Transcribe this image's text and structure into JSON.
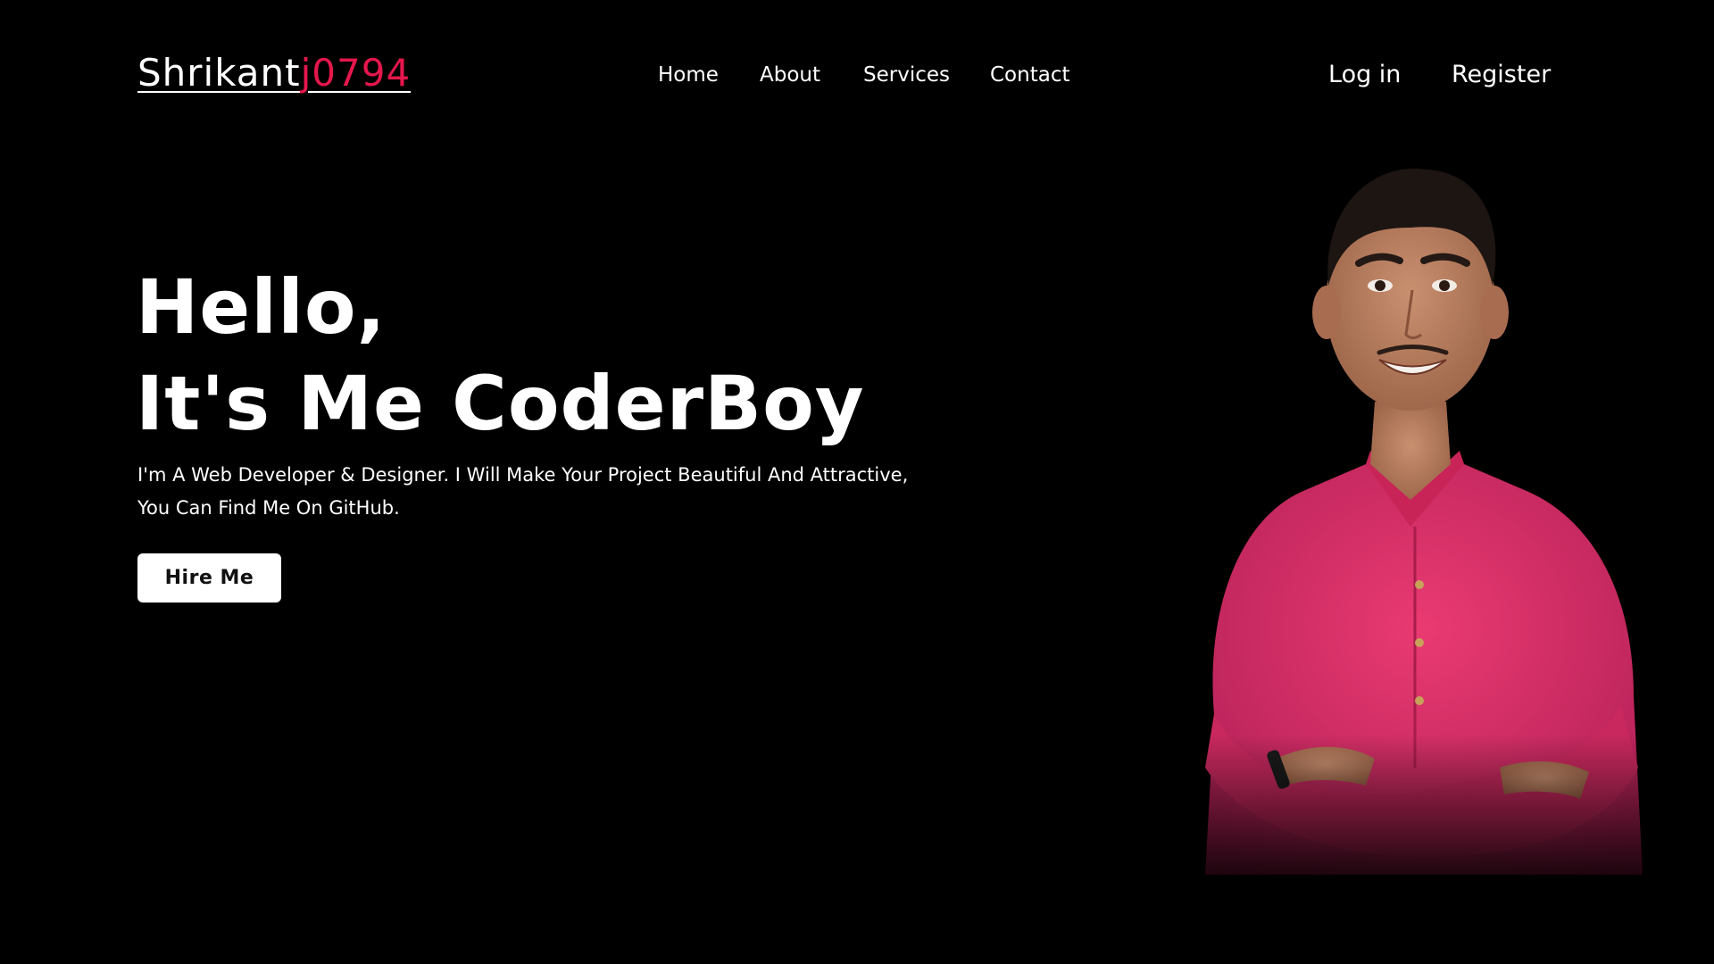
{
  "header": {
    "logo_main": "Shrikant",
    "logo_accent": "j0794",
    "nav": [
      "Home",
      "About",
      "Services",
      "Contact"
    ],
    "login_label": "Log in",
    "register_label": "Register"
  },
  "hero": {
    "title_line1": "Hello,",
    "title_line2": "It's Me CoderBoy",
    "description_line1": "I'm A Web Developer & Designer. I Will Make Your Project Beautiful And Attractive,",
    "description_line2": "You Can Find Me On GitHub.",
    "cta_label": "Hire Me"
  },
  "colors": {
    "background": "#000000",
    "text": "#ffffff",
    "accent": "#e5174c",
    "shirt": "#e0306a"
  }
}
